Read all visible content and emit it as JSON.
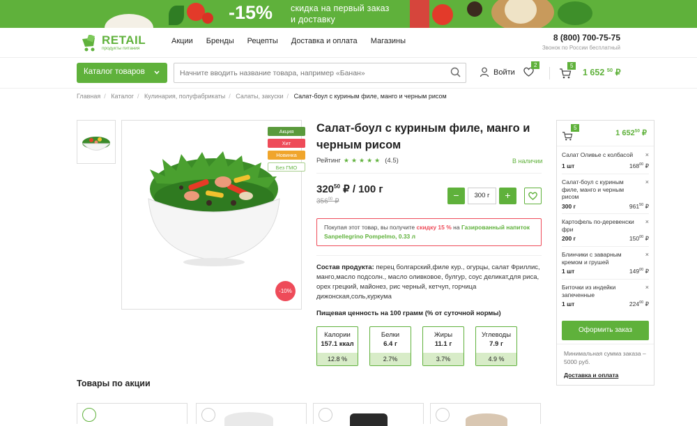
{
  "promo": {
    "percent": "-15%",
    "text_line1": "скидка на первый заказ",
    "text_line2": "и доставку"
  },
  "header": {
    "logo_title": "RETAIL",
    "logo_subtitle": "продукты питания",
    "nav": [
      "Акции",
      "Бренды",
      "Рецепты",
      "Доставка и оплата",
      "Магазины"
    ],
    "phone": "8 (800) 700-75-75",
    "phone_note": "Звонок по России бесплатный"
  },
  "search_bar": {
    "catalog_label": "Каталог товаров",
    "placeholder": "Начните вводить название товара, например «Банан»",
    "login_label": "Войти",
    "favorites_count": "2",
    "cart_count": "5",
    "cart_total_main": "1 652",
    "cart_total_cents": "50",
    "currency": "₽"
  },
  "breadcrumbs": [
    "Главная",
    "Каталог",
    "Кулинария, полуфабрикаты",
    "Салаты, закуски",
    "Салат-боул с куриным филе, манго и черным рисом"
  ],
  "product": {
    "title": "Салат-боул с куриным филе, манго и черным рисом",
    "rating_label": "Рейтинг",
    "rating_value": "(4.5)",
    "stock": "В наличии",
    "tags": [
      {
        "label": "Акция",
        "color": "#5a9a3c"
      },
      {
        "label": "Хит",
        "color": "#ee4b59"
      },
      {
        "label": "Новинка",
        "color": "#f0a52b"
      },
      {
        "label": "Без ГМО",
        "color": "#a8cf8e"
      }
    ],
    "discount_badge": "-10%",
    "price_main": "320",
    "price_cents": "50",
    "price_unit": "₽ / 100 г",
    "old_price_main": "356",
    "old_price_cents": "00",
    "old_price_currency": "₽",
    "qty_value": "300 г",
    "minus_label": "−",
    "plus_label": "+",
    "promo_text_1": "Покупая этот товар, вы получите ",
    "promo_discount": "скидку 15 %",
    "promo_text_2": " на ",
    "promo_gift": "Газированный напиток Sanpellegrino Pompelmo, 0.33 л",
    "composition_label": "Состав продукта:",
    "composition_text": " перец болгарский,филе кур., огурцы, салат Фриллис, манго,масло подсолн., масло оливковое, булгур, соус деликат,для риса, орех грецкий, майонез, рис черный, кетчуп, горчица дижонская,соль,куркума",
    "nutrition_title": "Пищевая ценность на 100 грамм (% от суточной нормы)",
    "nutrition": [
      {
        "name": "Калории",
        "value": "157.1 ккал",
        "percent": "12.8 %"
      },
      {
        "name": "Белки",
        "value": "6.4 г",
        "percent": "2.7%"
      },
      {
        "name": "Жиры",
        "value": "11.1 г",
        "percent": "3.7%"
      },
      {
        "name": "Углеводы",
        "value": "7.9 г",
        "percent": "4.9 %"
      }
    ]
  },
  "minicart": {
    "count": "5",
    "total_main": "1 652",
    "total_cents": "50",
    "currency": "₽",
    "items": [
      {
        "name": "Салат Оливье с колбасой",
        "qty": "1 шт",
        "price": "168",
        "cents": "00"
      },
      {
        "name": "Салат-боул с куриным филе, манго и черным рисом",
        "qty": "300 г",
        "price": "961",
        "cents": "50"
      },
      {
        "name": "Картофель по-деревенски фри",
        "qty": "200 г",
        "price": "150",
        "cents": "00"
      },
      {
        "name": "Блинчики с заварным кремом и грушей",
        "qty": "1 шт",
        "price": "149",
        "cents": "00"
      },
      {
        "name": "Биточки из индейки запеченные",
        "qty": "1 шт",
        "price": "224",
        "cents": "00"
      }
    ],
    "close_glyph": "×",
    "order_button": "Оформить заказ",
    "min_order": "Минимальная сумма заказа – 5000 руб.",
    "delivery_link": "Доставка и оплата"
  },
  "related": {
    "title": "Товары по акции"
  },
  "colors": {
    "accent": "#5fb13b",
    "sale": "#ee4b59"
  }
}
